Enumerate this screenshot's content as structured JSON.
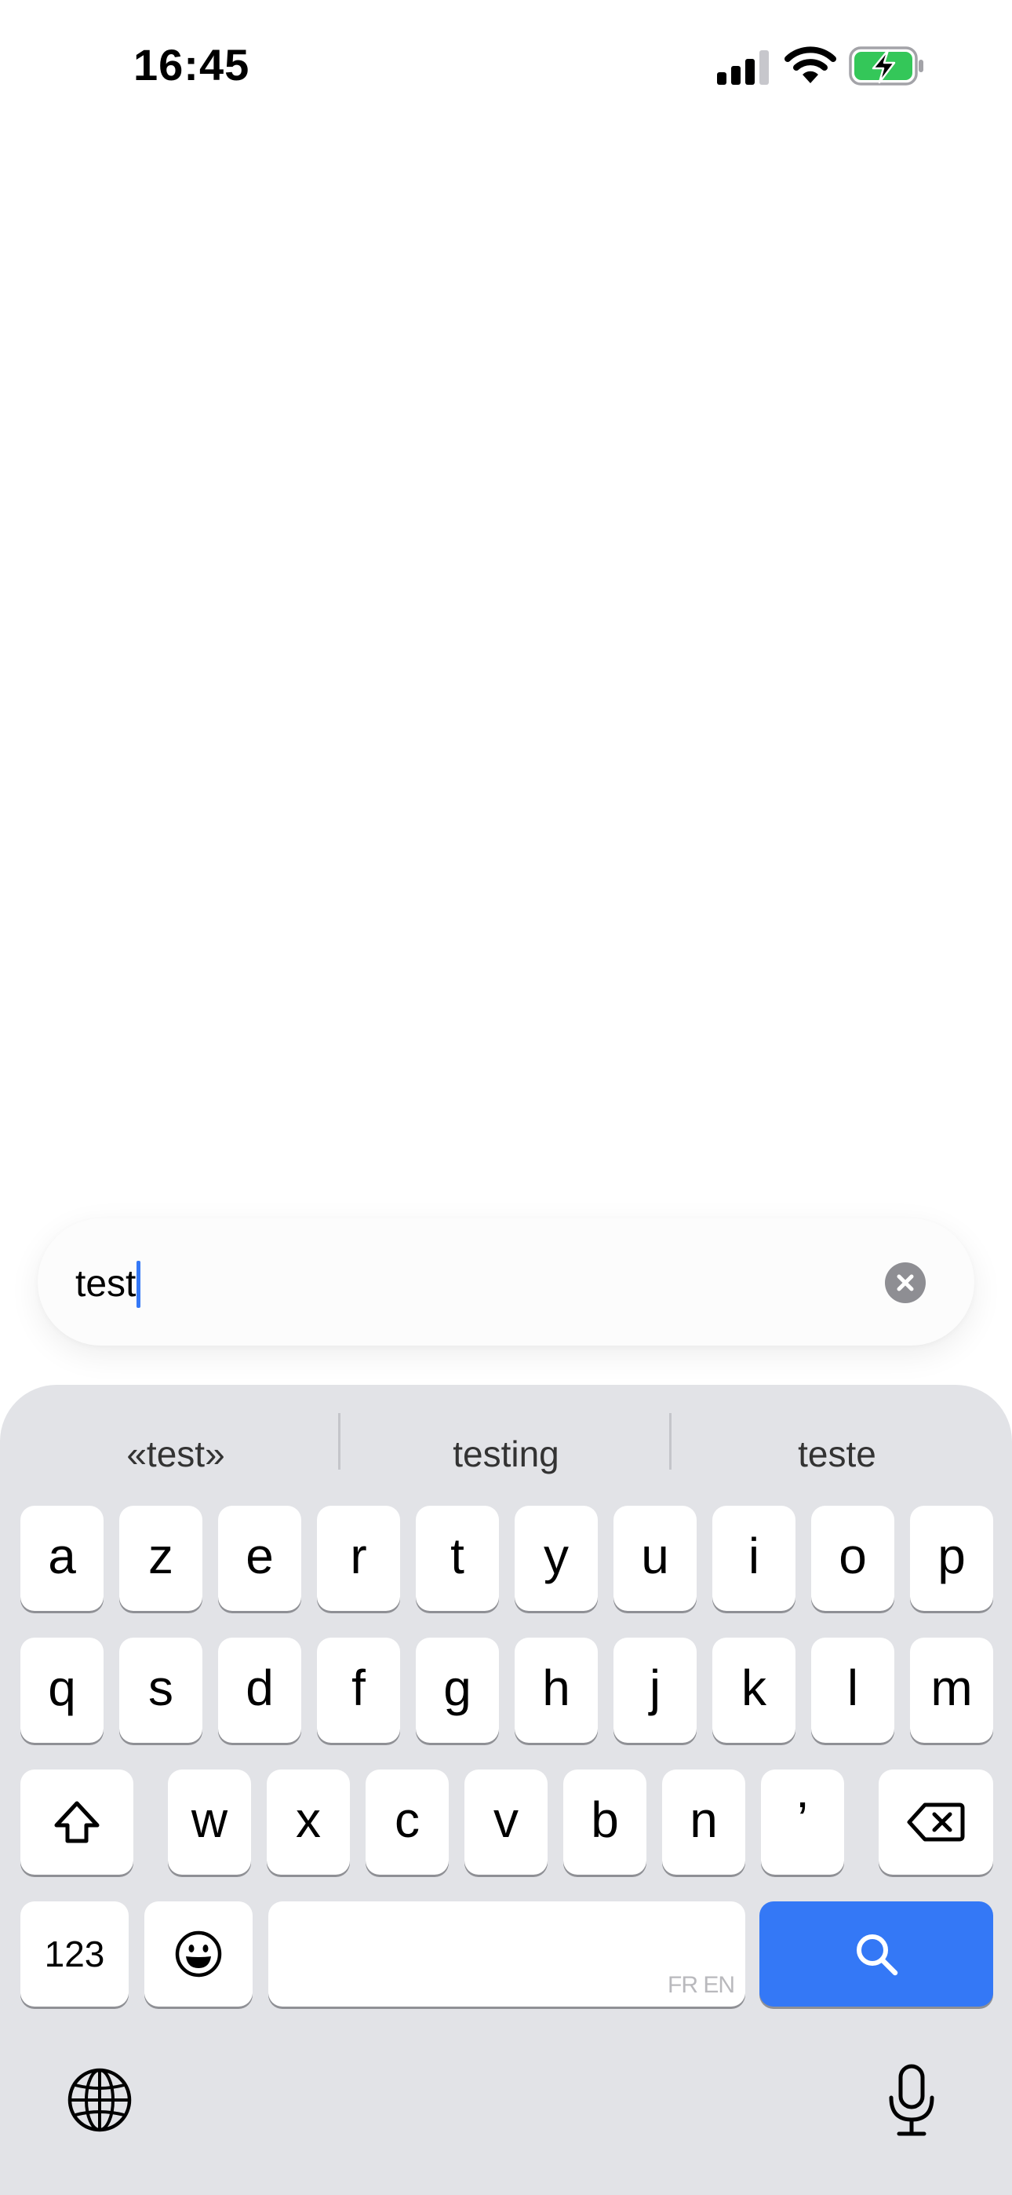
{
  "status_bar": {
    "time": "16:45",
    "signal_icon": "cellular-signal-icon",
    "wifi_icon": "wifi-icon",
    "battery_icon": "battery-charging-icon",
    "battery_color": "#34c759"
  },
  "search": {
    "value": "test",
    "clear_icon": "clear-icon"
  },
  "keyboard": {
    "suggestions": [
      "«test»",
      "testing",
      "teste"
    ],
    "row1": [
      "a",
      "z",
      "e",
      "r",
      "t",
      "y",
      "u",
      "i",
      "o",
      "p"
    ],
    "row2": [
      "q",
      "s",
      "d",
      "f",
      "g",
      "h",
      "j",
      "k",
      "l",
      "m"
    ],
    "row3": [
      "w",
      "x",
      "c",
      "v",
      "b",
      "n",
      "’"
    ],
    "shift_icon": "shift-icon",
    "delete_icon": "delete-icon",
    "numbers_label": "123",
    "emoji_icon": "emoji-icon",
    "space_hint": "FR EN",
    "search_icon": "search-icon",
    "search_key_color": "#3478f6",
    "globe_icon": "globe-icon",
    "mic_icon": "microphone-icon"
  }
}
